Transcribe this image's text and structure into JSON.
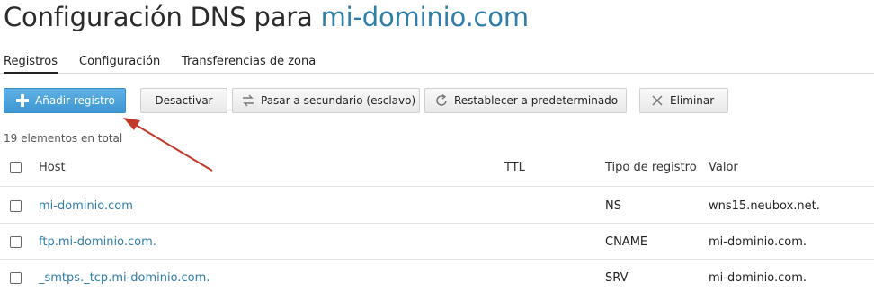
{
  "page": {
    "title_prefix": "Configuración DNS para ",
    "title_domain": "mi-dominio.com"
  },
  "tabs": [
    {
      "label": "Registros",
      "active": true
    },
    {
      "label": "Configuración",
      "active": false
    },
    {
      "label": "Transferencias de zona",
      "active": false
    }
  ],
  "toolbar": {
    "add_label": "Añadir registro",
    "deactivate_label": "Desactivar",
    "secondary_label": "Pasar a secundario (esclavo)",
    "reset_label": "Restablecer a predeterminado",
    "delete_label": "Eliminar"
  },
  "summary": {
    "count_text": "19 elementos en total"
  },
  "table": {
    "columns": {
      "host": "Host",
      "ttl": "TTL",
      "type": "Tipo de registro",
      "value": "Valor"
    },
    "rows": [
      {
        "host": "mi-dominio.com",
        "ttl": "",
        "type": "NS",
        "value": "wns15.neubox.net."
      },
      {
        "host": "ftp.mi-dominio.com.",
        "ttl": "",
        "type": "CNAME",
        "value": "mi-dominio.com."
      },
      {
        "host": "_smtps._tcp.mi-dominio.com.",
        "ttl": "",
        "type": "SRV",
        "value": "mi-dominio.com."
      }
    ]
  },
  "colors": {
    "accent": "#2f7ea8",
    "primary_button": "#4aa2dc",
    "annotation_arrow": "#c0392b"
  },
  "icons": {
    "add": "plus-icon",
    "secondary": "swap-arrows-icon",
    "reset": "refresh-icon",
    "delete": "close-icon"
  }
}
